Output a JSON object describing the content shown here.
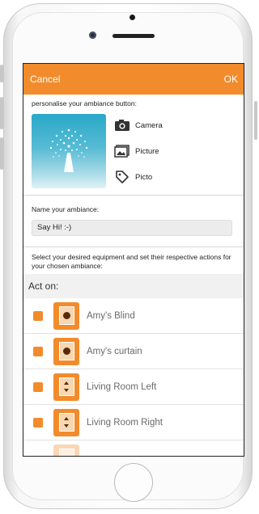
{
  "navbar": {
    "cancel_label": "Cancel",
    "ok_label": "OK",
    "color": "#f28b2b"
  },
  "ambiance_button": {
    "heading": "personalise your ambiance button:",
    "options": [
      {
        "icon": "camera-icon",
        "label": "Camera"
      },
      {
        "icon": "picture-icon",
        "label": "Picture"
      },
      {
        "icon": "tag-icon",
        "label": "Picto"
      }
    ]
  },
  "ambiance_name": {
    "label": "Name your ambiance:",
    "value": "Say Hi! :-)"
  },
  "instructions": "Select your desired equipment and set their respective actions for your chosen ambiance:",
  "act_on": {
    "title": "Act on:",
    "items": [
      {
        "label": "Amy's Blind",
        "icon": "blind-icon",
        "checked": true
      },
      {
        "label": "Amy's curtain",
        "icon": "blind-icon",
        "checked": true
      },
      {
        "label": "Living Room Left",
        "icon": "up-down-icon",
        "checked": true
      },
      {
        "label": "Living Room Right",
        "icon": "up-down-icon",
        "checked": true
      }
    ]
  }
}
